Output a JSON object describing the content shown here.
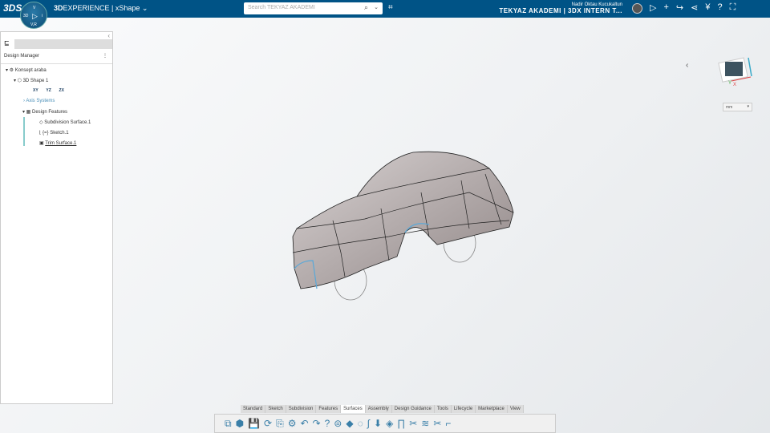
{
  "topbar": {
    "logo": "3DS",
    "compass": {
      "top": "V",
      "left": "3D",
      "right": "i",
      "bottom": "V,R"
    },
    "brand_bold": "3D",
    "brand_rest": "EXPERIENCE | ",
    "app": "xShape ⌄",
    "search_placeholder": "Search TEKYAZ AKADEMI",
    "user_name": "Nadir Oktau Kucukaltun",
    "company": "TEKYAZ AKADEMI | 3DX INTERN T...",
    "icons": [
      "tag-icon",
      "compass-share-icon",
      "plus-icon",
      "share-icon",
      "network-icon",
      "apps-icon",
      "help-icon",
      "fullscreen-icon"
    ]
  },
  "panel": {
    "tab_icon": "tree-icon",
    "title": "Design Manager",
    "tree": [
      {
        "label": "Konsept araba",
        "level": 0
      },
      {
        "label": "3D Shape 1",
        "level": 1
      },
      {
        "label": "Axis Systems",
        "level": 2
      },
      {
        "label": "Design Features",
        "level": 2
      },
      {
        "label": "Subdivision Surface.1",
        "level": 3
      },
      {
        "label": "{=} Sketch.1",
        "level": 3
      },
      {
        "label": "Trim Surface.1",
        "level": 3
      }
    ],
    "planes": [
      "XY",
      "YZ",
      "ZX"
    ]
  },
  "viewport": {
    "compass_axes": {
      "z": "Z",
      "y": "Y",
      "x": "X"
    },
    "unit": "mm"
  },
  "action_bar": {
    "tabs": [
      "Standard",
      "Sketch",
      "Subdivision",
      "Features",
      "Surfaces",
      "Assembly",
      "Design Guidance",
      "Tools",
      "Lifecycle",
      "Marketplace",
      "View"
    ],
    "active_tab": "Surfaces",
    "tools": [
      "⧉",
      "⬢",
      "💾",
      "⟳",
      "⎘",
      "⚙",
      "↶",
      "↷",
      "?",
      "⊜",
      "◆",
      "◌",
      "∫",
      "⬇",
      "◈",
      "∏",
      "✂",
      "≋",
      "✂",
      "⌐"
    ]
  }
}
